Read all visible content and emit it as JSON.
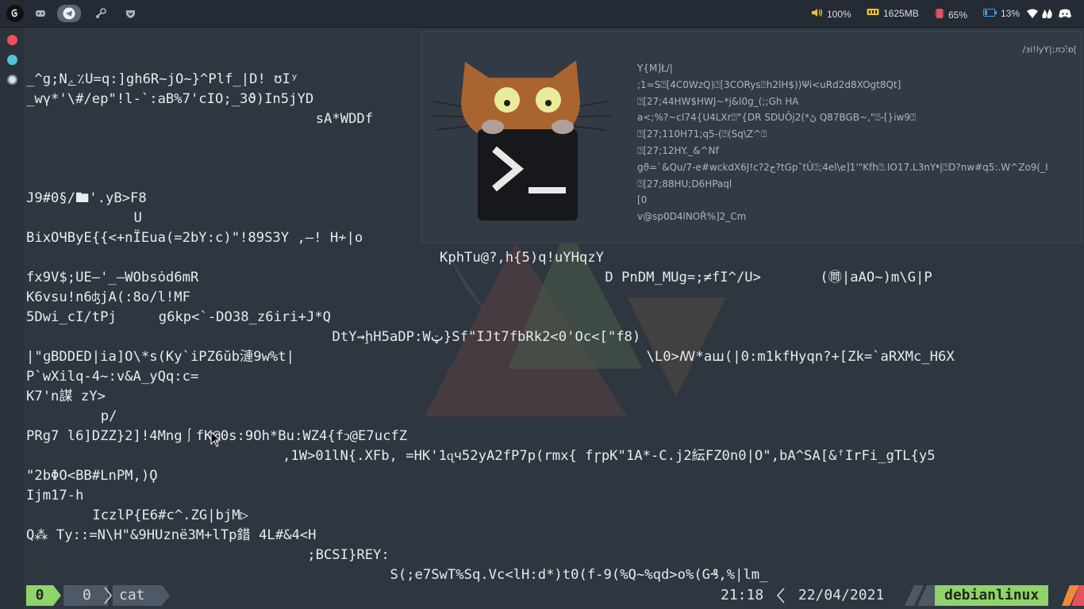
{
  "topbar": {
    "icons": [
      "debian-icon",
      "gamepad-icon",
      "telegram-icon",
      "steam-icon",
      "shield-icon"
    ],
    "volume": "100%",
    "memory": "1625MB",
    "cpu": "65%",
    "battery": "13%",
    "tray": [
      "wifi-icon",
      "flames-icon",
      "discord-icon"
    ]
  },
  "colors": {
    "background": "#2e3640",
    "dot_red": "#ef4f5b",
    "dot_blue": "#4fc3d9",
    "dot_white": "#dcdfe4",
    "status_green": "#8fd36b",
    "status_gray": "#5a6472"
  },
  "terminal": {
    "lines": [
      {
        "text": "_^g;Nﮮ٪U=q:]gh6R~jO~}^Plf_|D! ʊIʸ",
        "col": 0,
        "row": 0
      },
      {
        "text": "_wγ*'\\#/ep\"!l-`:aB%7'cIO;_3ϑ)In5jYD",
        "col": 0,
        "row": 1
      },
      {
        "text": "sA*WDDf",
        "col": 35,
        "row": 2
      },
      {
        "text": "J9#0§/🖿'.yB>F8",
        "col": 0,
        "row": 6
      },
      {
        "text": "U",
        "col": 13,
        "row": 7
      },
      {
        "text": "BixOЧByE{{<+nЇEua(=2bY:c)\"!89S3Y ,—! H≁|o",
        "col": 0,
        "row": 8
      },
      {
        "text": "KphTu@?,h{5)q!uYHqzY",
        "col": 50,
        "row": 9
      },
      {
        "text": "fx9V$;UE—'_—WObsȯd6mR",
        "col": 0,
        "row": 10
      },
      {
        "text": "D PnDM_MUg=;≠fI^/U>",
        "col": 70,
        "row": 10
      },
      {
        "text": "(㉄|aAO~)m\\G|P",
        "col": 96,
        "row": 10
      },
      {
        "text": "K6vsu!n6ʤjA(:8o/l!MF",
        "col": 0,
        "row": 11
      },
      {
        "text": "5Dwi̲cI/tPj",
        "col": 0,
        "row": 12
      },
      {
        "text": "g6kp<`-DO38_z6iri+J*Q",
        "col": 16,
        "row": 12
      },
      {
        "text": "DtY⇝ḩH5aDP:Wټ}Sf\"IJt7fbRk2<0'Oc<[\"f8)",
        "col": 37,
        "row": 13
      },
      {
        "text": "|\"ɡBDDED|ia]O\\*s(Ky`iPZ6ŭb漣9w%t|",
        "col": 0,
        "row": 14
      },
      {
        "text": "\\L0>ꟿ*aꟺ(|0:m1kfHyqn?+[Zk=`aRXMc_H6X",
        "col": 75,
        "row": 14
      },
      {
        "text": "P`wXilq-4~:v&A_yQq:c=",
        "col": 0,
        "row": 15
      },
      {
        "text": "K7'n謀 zY>",
        "col": 0,
        "row": 16
      },
      {
        "text": "p/",
        "col": 9,
        "row": 17
      },
      {
        "text": "PRg7 l6]DZZ}2]!4Mng⎰fK@0s:9Oh*Bu:WZ4{fↄ@E7ucfZ",
        "col": 0,
        "row": 18
      },
      {
        "text": ",1W>01lN{.XFb, =HK'1ɋч52yA2fP7p(rmx{ fɼpK\"1A*-C.j2紜FZ0n0|O\",bA^SA[&ᶠIrFi_gTL{y5",
        "col": 31,
        "row": 19
      },
      {
        "text": "\"2bΦO<BB#LnPM,)Ϙ",
        "col": 0,
        "row": 20
      },
      {
        "text": "Ijm17-h",
        "col": 0,
        "row": 21
      },
      {
        "text": "IczlP{E6#c^.ZG|bjM▷",
        "col": 8,
        "row": 22
      },
      {
        "text": "Q⁂ Ty::=N\\H\"&9HUznë3M+lTp錯 4L#&4<H",
        "col": 0,
        "row": 23
      },
      {
        "text": ";BCSI}REY:",
        "col": 34,
        "row": 24
      },
      {
        "text": "S(;e7SwT%Sq.Vc<lH:d*)t0(f-9(%Q~%qd>o%(G₰,%|lm_",
        "col": 44,
        "row": 25
      }
    ]
  },
  "notification": {
    "lines": [
      "Y{M]Ł/|",
      ";1=S⍰[4C0WzQ)⍰[3CORys⍰h2lH$))Ψi<uRd2d8XOgt8Qt]",
      "⍰[27;44HW$HWJ~*j&l0g_(;;Gh HA",
      "a<;%?~cI74{U4LXr⍰\"{DR SDUÔj2(*ڻ Q87BGB~,\"⍰-[}iw9⍰",
      "⍰[27;110H71;q5-(⍰(Sq\\Z^⍰",
      "⍰[27;12HY._&^Nf",
      "gϑ=`&Qu/7-e#wckdX6J!c?2ج?tGpˇtÛ⍰;4el\\e]1'\"Kfh⍰.IO17.L3nYᵜ|⍰D?nw#q5:.W^Zo9(_I",
      "⍰[27;88HU;D6HPaql",
      "[0",
      "v@sp0D4lNOŘ%]2_Cm"
    ],
    "corner": "/ɜi!lyY|;ᴫɔ:̌ᴆ["
  },
  "status": {
    "left_a": "0",
    "left_b": "0",
    "command": "cat",
    "time": "21:18",
    "date": "22/04/2021",
    "host": "debianlinux"
  }
}
